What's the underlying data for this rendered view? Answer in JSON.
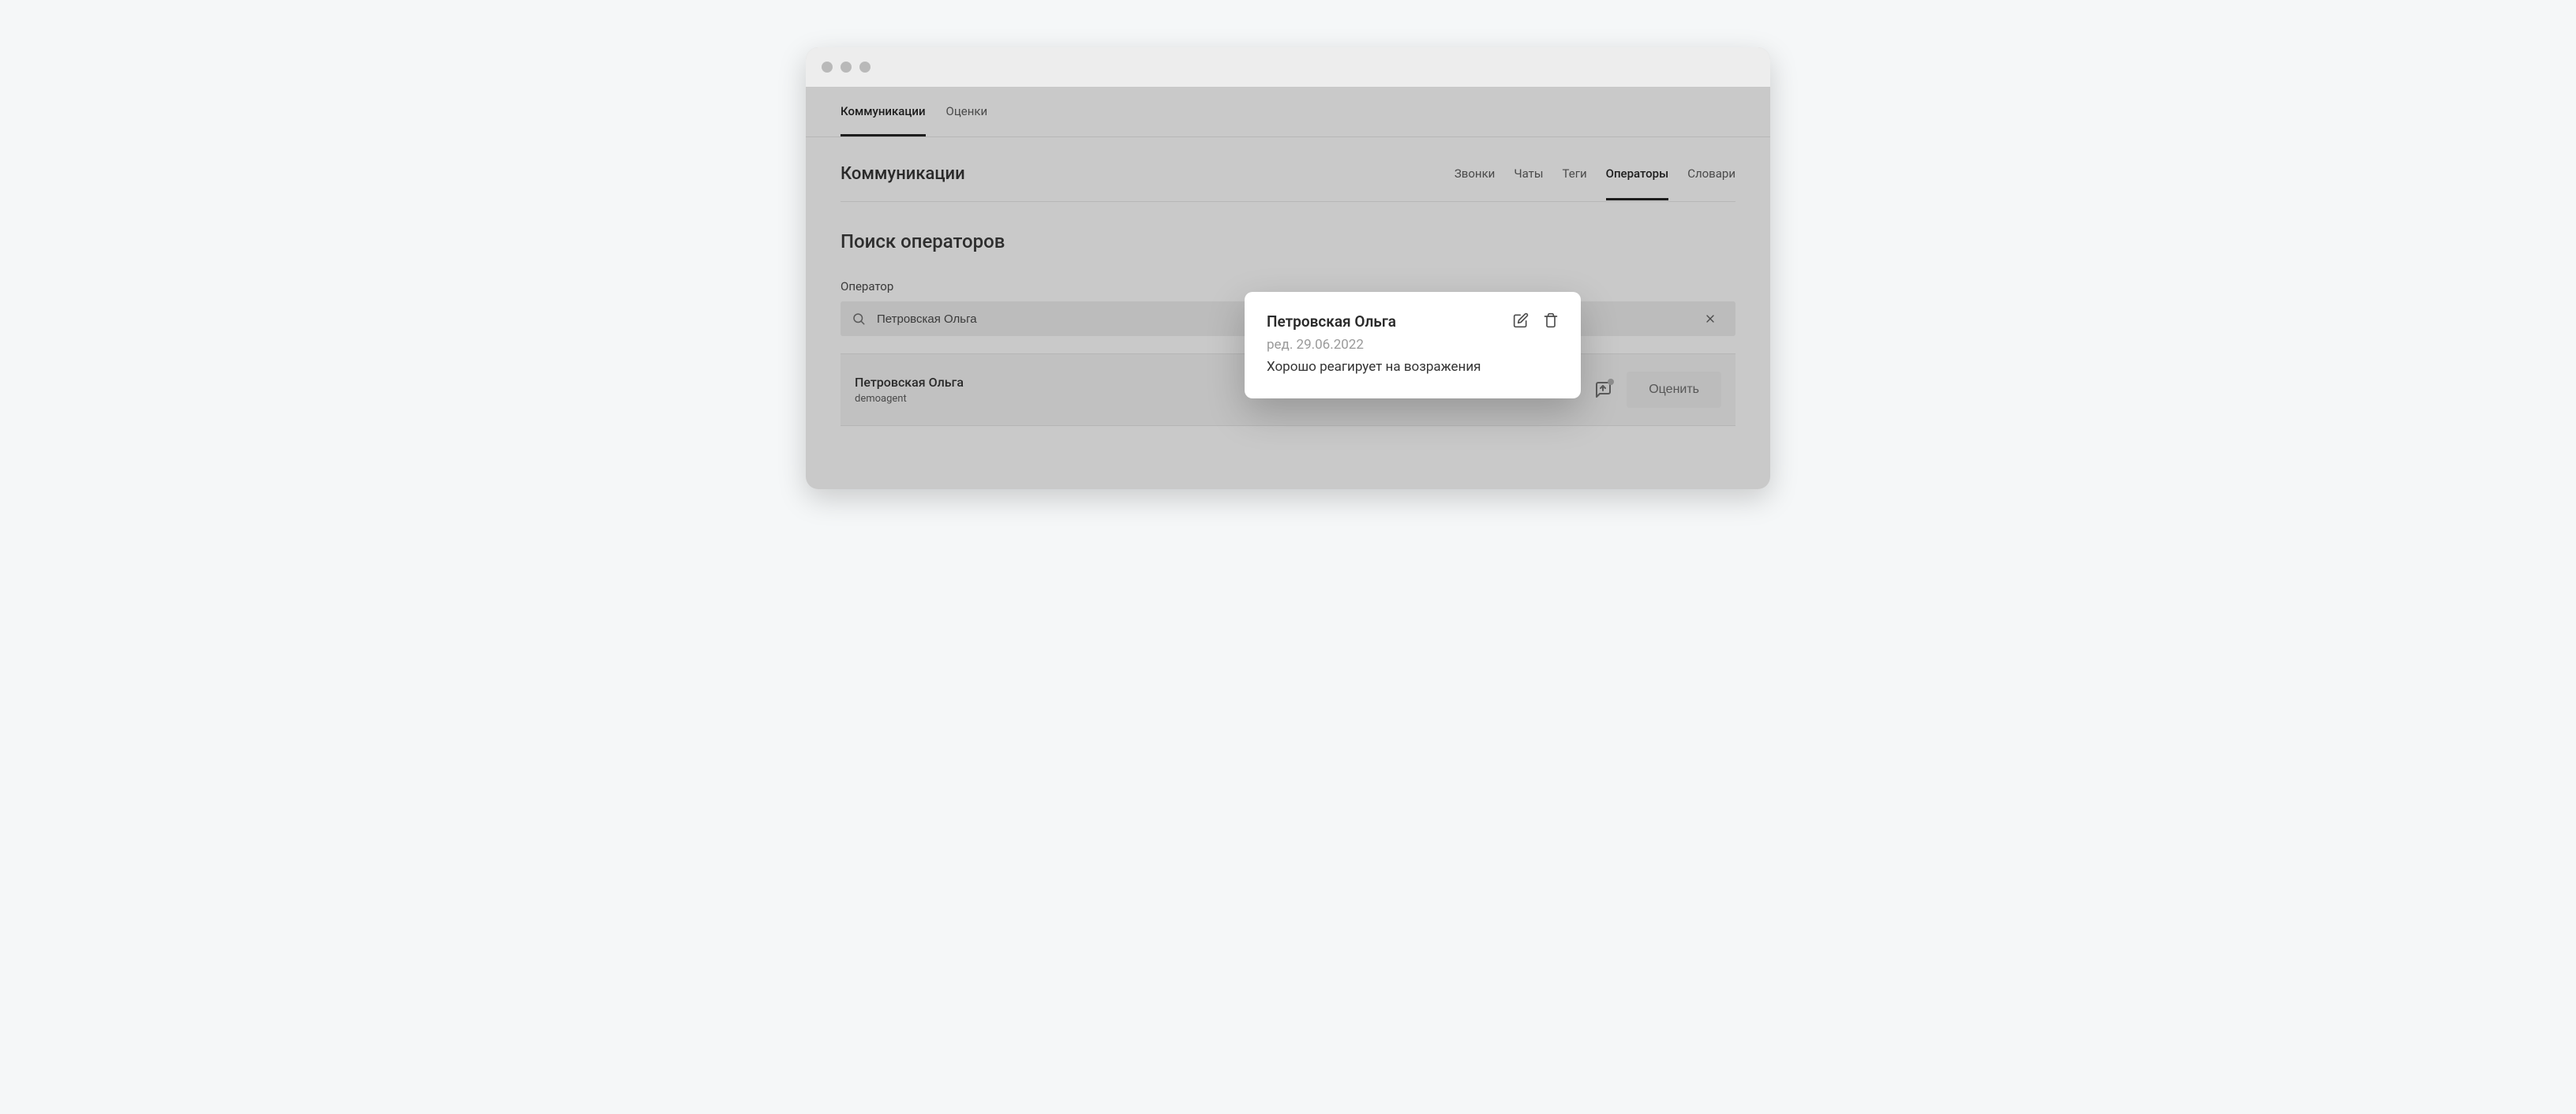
{
  "topnav": {
    "items": [
      {
        "label": "Коммуникации",
        "active": true
      },
      {
        "label": "Оценки",
        "active": false
      }
    ]
  },
  "section": {
    "title": "Коммуникации",
    "subtabs": [
      {
        "label": "Звонки",
        "active": false
      },
      {
        "label": "Чаты",
        "active": false
      },
      {
        "label": "Теги",
        "active": false
      },
      {
        "label": "Операторы",
        "active": true
      },
      {
        "label": "Словари",
        "active": false
      }
    ]
  },
  "page": {
    "subtitle": "Поиск операторов"
  },
  "search": {
    "label": "Оператор",
    "value": "Петровская Ольга"
  },
  "result": {
    "name": "Петровская Ольга",
    "subtitle": "demoagent",
    "rate_label": "Оценить"
  },
  "popover": {
    "title": "Петровская Ольга",
    "meta": "ред. 29.06.2022",
    "body": "Хорошо реагирует на возражения"
  }
}
